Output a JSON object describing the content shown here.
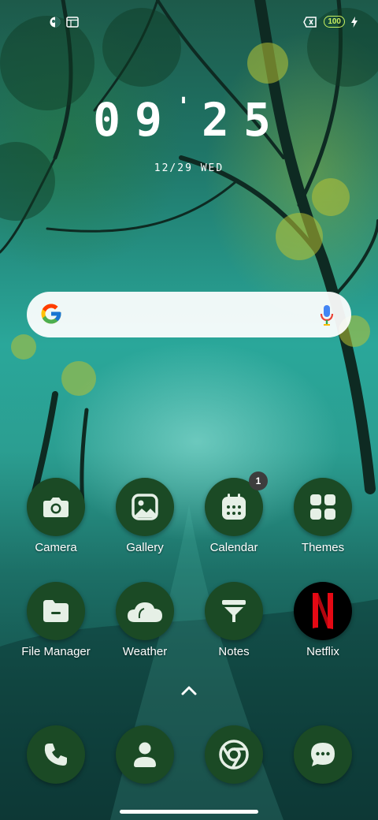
{
  "status_bar": {
    "left_icons": [
      "assistant-icon",
      "screen-icon"
    ],
    "right_icons": [
      "battery-saver-icon",
      "battery-icon",
      "charging-icon"
    ],
    "battery_level": "100"
  },
  "clock": {
    "hh": "09",
    "mm": "25"
  },
  "date": "12/29 WED",
  "search": {
    "logo": "google-g-icon",
    "mic": "mic-icon"
  },
  "apps": [
    {
      "label": "Camera",
      "icon": "camera-icon"
    },
    {
      "label": "Gallery",
      "icon": "gallery-icon"
    },
    {
      "label": "Calendar",
      "icon": "calendar-icon",
      "badge": "1"
    },
    {
      "label": "Themes",
      "icon": "themes-icon"
    },
    {
      "label": "File Manager",
      "icon": "file-manager-icon"
    },
    {
      "label": "Weather",
      "icon": "weather-icon"
    },
    {
      "label": "Notes",
      "icon": "notes-icon"
    },
    {
      "label": "Netflix",
      "icon": "netflix-icon"
    }
  ],
  "dock": [
    {
      "icon": "phone-icon"
    },
    {
      "icon": "contacts-icon"
    },
    {
      "icon": "chrome-icon"
    },
    {
      "icon": "messages-icon"
    }
  ],
  "colors": {
    "icon_bg": "#1b4a25",
    "battery": "#c8f060",
    "netflix_red": "#e50914"
  }
}
